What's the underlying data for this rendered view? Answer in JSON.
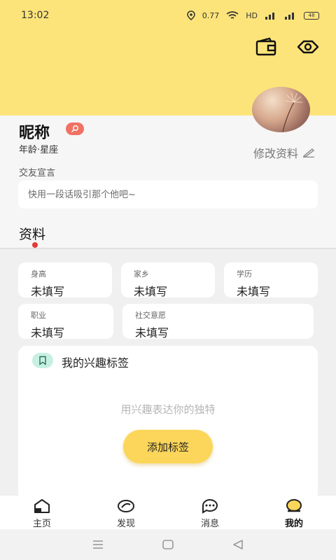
{
  "status_bar": {
    "time": "13:02",
    "net_speed": "0.77",
    "network_label": "HD",
    "battery": "48"
  },
  "profile": {
    "nickname": "昵称",
    "age_constellation": "年龄·星座",
    "edit_label": "修改资料",
    "motto_label": "交友宣言",
    "motto_placeholder": "快用一段话吸引那个他吧~"
  },
  "section_tab": "资料",
  "fields": [
    {
      "label": "身高",
      "value": "未填写"
    },
    {
      "label": "家乡",
      "value": "未填写"
    },
    {
      "label": "学历",
      "value": "未填写"
    },
    {
      "label": "职业",
      "value": "未填写"
    },
    {
      "label": "社交意愿",
      "value": "未填写"
    }
  ],
  "interests": {
    "title": "我的兴趣标签",
    "empty_hint": "用兴趣表达你的独特",
    "add_button": "添加标签"
  },
  "bottom_nav": [
    {
      "label": "主页",
      "icon": "home-icon"
    },
    {
      "label": "发现",
      "icon": "discover-icon"
    },
    {
      "label": "消息",
      "icon": "message-icon"
    },
    {
      "label": "我的",
      "icon": "profile-icon",
      "active": true
    }
  ],
  "colors": {
    "header_yellow": "#fde47a",
    "button_yellow": "#fcd65a",
    "badge_red": "#f07264",
    "dot_red": "#e53935"
  }
}
